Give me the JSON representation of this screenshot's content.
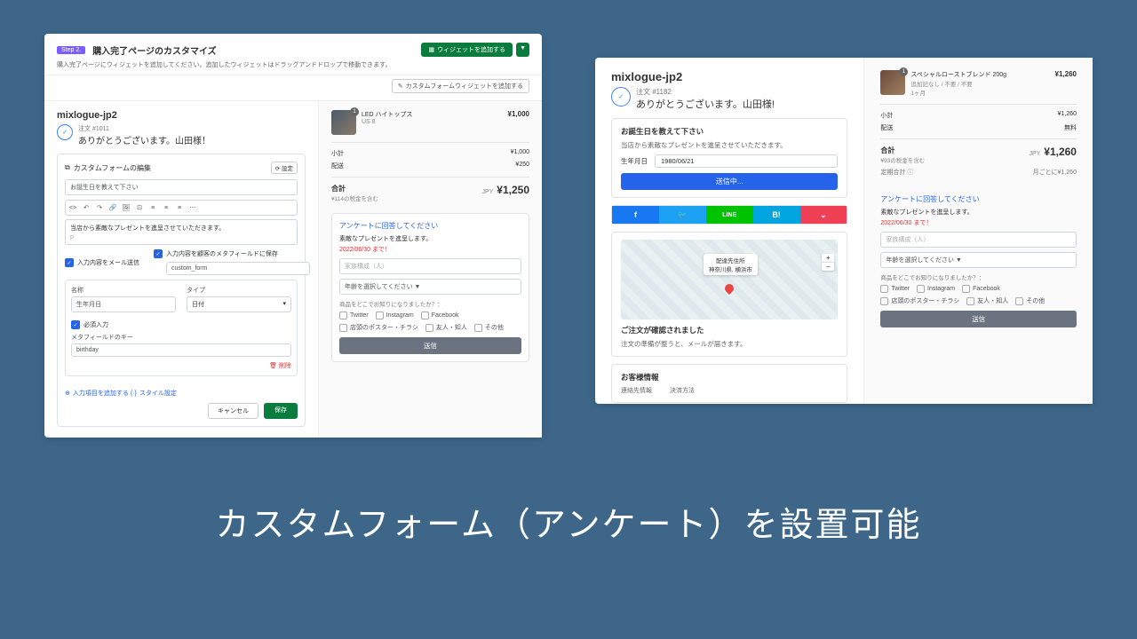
{
  "headline": "カスタムフォーム（アンケート）を設置可能",
  "s1": {
    "step_badge": "Step 2.",
    "title": "購入完了ページのカスタマイズ",
    "subtitle": "購入完了ページにウィジェットを追加してください。追加したウィジェットはドラッグアンドドロップで移動できます。",
    "add_widget_btn": "ウィジェットを追加する",
    "add_custom_btn": "カスタムフォームウィジェットを追加する",
    "store": "mixlogue-jp2",
    "order_no": "注文 #1011",
    "thankyou": "ありがとうございます。山田様！",
    "form_editor_title": "カスタムフォームの編集",
    "settings_tag": "設定",
    "q_placeholder": "お誕生日を教えて下さい",
    "body_text": "当店から素敵なプレゼントを進呈させていただきます。",
    "chk_email": "入力内容をメール送信",
    "chk_meta": "入力内容を顧客のメタフィールドに保存",
    "meta_value": "custom_form",
    "name_label": "名称",
    "name_value": "生年月日",
    "type_label": "タイプ",
    "type_value": "日付",
    "required_label": "必須入力",
    "metakey_label": "メタフィールドのキー",
    "metakey_value": "birthday",
    "delete": "削除",
    "add_field": "入力項目を追加する",
    "style_link": "スタイル設定",
    "cancel": "キャンセル",
    "save": "保存",
    "product": {
      "name": "LED ハイトップス",
      "variant": "US 8",
      "qty": "1",
      "price": "¥1,000"
    },
    "summary": {
      "subtotal_l": "小計",
      "subtotal_v": "¥1,000",
      "ship_l": "配送",
      "ship_v": "¥250",
      "total_l": "合計",
      "total_note": "¥114の税金を含む",
      "total_cur": "JPY",
      "total_v": "¥1,250"
    },
    "survey": {
      "title": "アンケートに回答してください",
      "line1": "素敵なプレゼントを進呈します。",
      "deadline": "2022/06/30 まで！",
      "family": "家族構成（人）",
      "age_sel": "年齢を選択してください ▼",
      "know_q": "商品をどこでお知りになりましたか？：",
      "opts": [
        "Twitter",
        "Instagram",
        "Facebook",
        "店頭のポスター・チラシ",
        "友人・知人",
        "その他"
      ],
      "send": "送信"
    }
  },
  "s2": {
    "store": "mixlogue-jp2",
    "order_no": "注文 #1182",
    "thankyou": "ありがとうございます。山田様!",
    "card1": {
      "title": "お誕生日を教えて下さい",
      "desc": "当店から素敵なプレゼントを進呈させていただきます。",
      "dob_l": "生年月日",
      "dob_v": "1980/06/21",
      "btn": "送信中..."
    },
    "map_tip_title": "配達先住所",
    "map_tip_addr": "神奈川県, 横浜市",
    "confirm_title": "ご注文が確認されました",
    "confirm_desc": "注文の準備が整うと、メールが届きます。",
    "cust_title": "お客様情報",
    "cust_l": "連絡先情報",
    "cust_r": "決済方法",
    "product": {
      "name": "スペシャルローストブレンド 200g",
      "variant": "追加記なし / 不要 / 不要",
      "sub": "1ヶ月",
      "qty": "1",
      "price": "¥1,260"
    },
    "summary": {
      "subtotal_l": "小計",
      "subtotal_v": "¥1,260",
      "ship_l": "配送",
      "ship_v": "無料",
      "total_l": "合計",
      "total_note": "¥93の税金を含む",
      "total_cur": "JPY",
      "total_v": "¥1,260",
      "recur_l": "定期合計 ⓘ",
      "recur_v": "月ごとに¥1,260"
    },
    "survey": {
      "title": "アンケートに回答してください",
      "line1": "素敵なプレゼントを進呈します。",
      "deadline": "2022/06/30 まで！",
      "family": "家族構成（人）",
      "age_sel": "年齢を選択してください ▼",
      "know_q": "商品をどこでお知りになりましたか？：",
      "opts": [
        "Twitter",
        "Instagram",
        "Facebook",
        "店頭のポスター・チラシ",
        "友人・知人",
        "その他"
      ],
      "send": "送信"
    },
    "social_colors": [
      "#1877f2",
      "#1da1f2",
      "#00c300",
      "#00a4de",
      "#ef4056"
    ],
    "social_labels": [
      "f",
      "🐦",
      "LINE",
      "B!",
      "⌄"
    ]
  }
}
